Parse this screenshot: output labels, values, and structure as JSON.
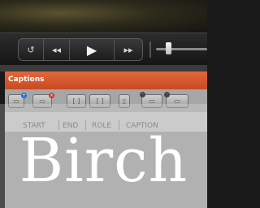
{
  "player": {
    "controls": {
      "loop_icon": "↺",
      "rewind_icon": "◂◂",
      "play_icon": "▶",
      "forward_icon": "▸▸"
    }
  },
  "captions_panel": {
    "title": "Captions",
    "toolbar_icons": [
      "add-caption-icon",
      "delete-caption-icon",
      "caption-frame-icon",
      "caption-frame-icon",
      "document-icon",
      "caption-link-icon",
      "caption-unlink-icon"
    ],
    "columns": [
      "START",
      "END",
      "ROLE",
      "CAPTION"
    ]
  },
  "overlay_text": "Birch",
  "colors": {
    "header_accent": "#d95a2d",
    "add_badge": "#1e6fd0",
    "delete_badge": "#d0312a"
  }
}
